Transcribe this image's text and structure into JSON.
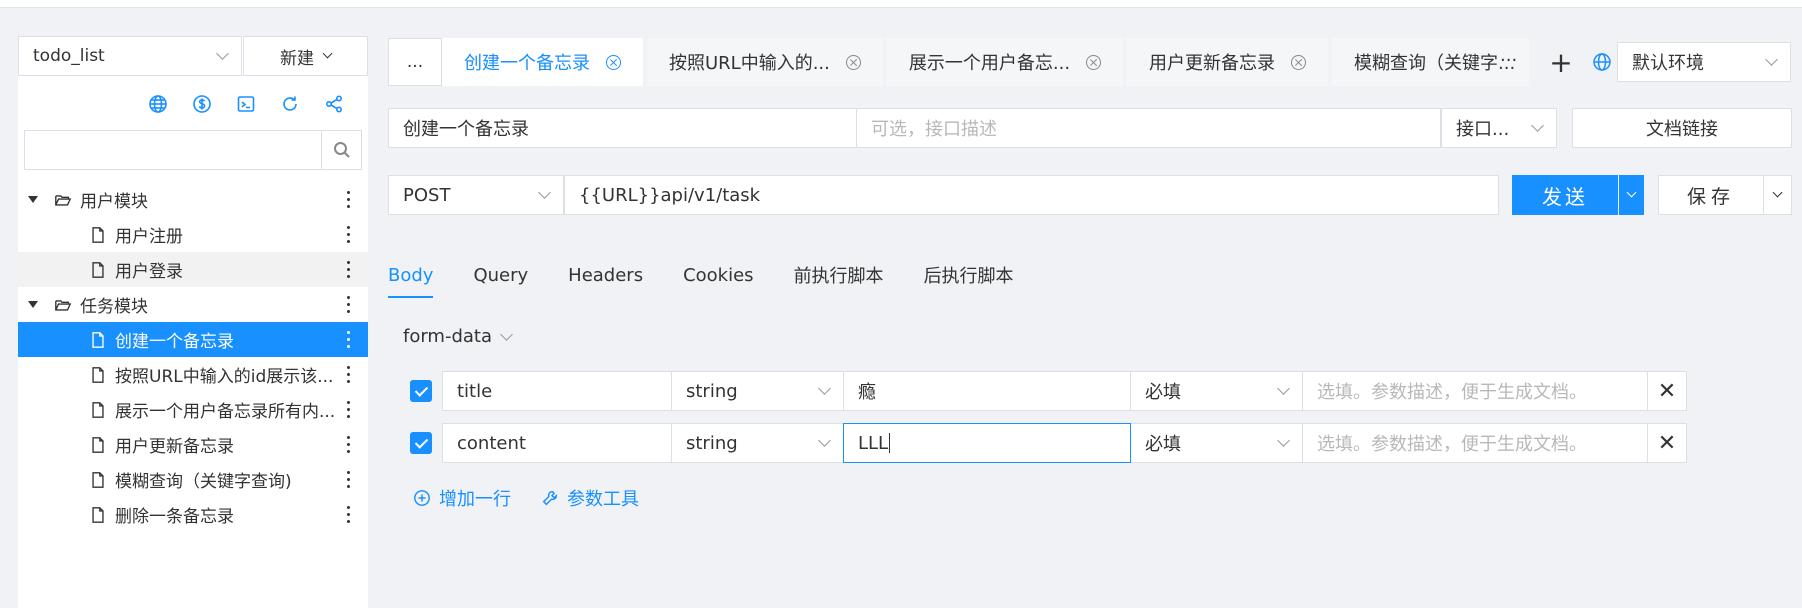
{
  "sidebar": {
    "project": "todo_list",
    "new_label": "新建",
    "search_placeholder": "",
    "tree": [
      {
        "type": "folder",
        "label": "用户模块"
      },
      {
        "type": "leaf",
        "label": "用户注册"
      },
      {
        "type": "leaf",
        "label": "用户登录",
        "hover": true
      },
      {
        "type": "folder",
        "label": "任务模块"
      },
      {
        "type": "leaf",
        "label": "创建一个备忘录",
        "active": true
      },
      {
        "type": "leaf",
        "label": "按照URL中输入的id展示该..."
      },
      {
        "type": "leaf",
        "label": "展示一个用户备忘录所有内..."
      },
      {
        "type": "leaf",
        "label": "用户更新备忘录"
      },
      {
        "type": "leaf",
        "label": "模糊查询（关键字查询)"
      },
      {
        "type": "leaf",
        "label": "删除一条备忘录"
      }
    ]
  },
  "tabs": {
    "more_left": "...",
    "items": [
      {
        "label": "创建一个备忘录",
        "active": true
      },
      {
        "label": "按照URL中输入的..."
      },
      {
        "label": "展示一个用户备忘..."
      },
      {
        "label": "用户更新备忘录"
      },
      {
        "label": "模糊查询（关键字..."
      }
    ],
    "more_right": "···",
    "add": "+",
    "environment": "默认环境"
  },
  "request": {
    "name": "创建一个备忘录",
    "description_placeholder": "可选，接口描述",
    "interface": "接口...",
    "doc_link": "文档链接",
    "method": "POST",
    "url": "{{URL}}api/v1/task",
    "send": "发送",
    "save": "保存"
  },
  "subtabs": [
    "Body",
    "Query",
    "Headers",
    "Cookies",
    "前执行脚本",
    "后执行脚本"
  ],
  "body": {
    "form_type": "form-data",
    "params": [
      {
        "key": "title",
        "type": "string",
        "value": "瘾",
        "required": "必填",
        "desc_placeholder": "选填。参数描述，便于生成文档。"
      },
      {
        "key": "content",
        "type": "string",
        "value": "LLL",
        "required": "必填",
        "desc_placeholder": "选填。参数描述，便于生成文档。"
      }
    ],
    "add_row": "增加一行",
    "param_tool": "参数工具"
  },
  "colors": {
    "accent": "#1890ff",
    "background": "#f0f2f5"
  }
}
